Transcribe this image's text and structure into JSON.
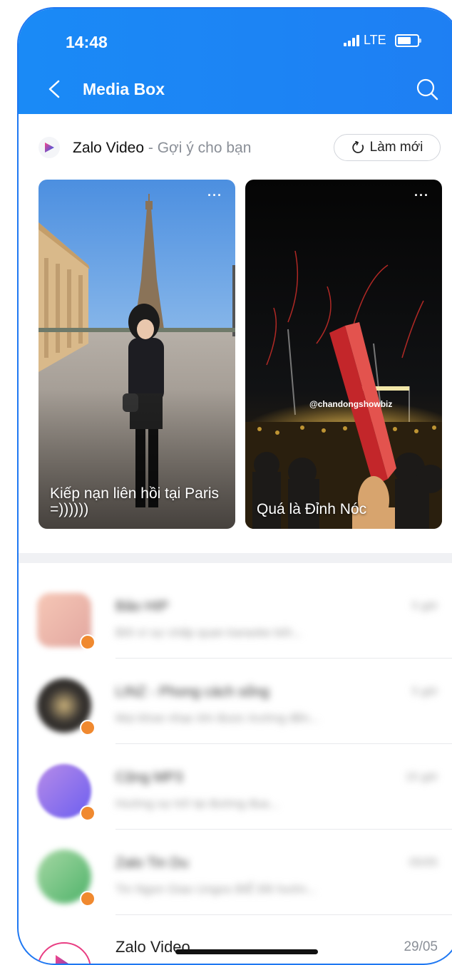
{
  "status_bar": {
    "time": "14:48",
    "network": "LTE"
  },
  "header": {
    "title": "Media Box"
  },
  "zalo_video_section": {
    "brand": "Zalo Video",
    "separator": " - ",
    "subtitle": "Gợi ý cho bạn",
    "refresh_label": "Làm mới"
  },
  "video_cards": [
    {
      "caption": "Kiếp nạn liên hồi tại Paris =))))))",
      "menu": "···"
    },
    {
      "caption": "Quá là Đỉnh Nóc",
      "menu": "···",
      "watermark": "@chandongshowbiz"
    }
  ],
  "conversations": [
    {
      "name": "Bảo HIP",
      "preview": "Bởi vì sự chấp quan karaoke bởi...",
      "time": "5 giờ"
    },
    {
      "name": "LINZ - Phong cách sống",
      "preview": "Mọi khoe nhạc khi được trường đến...",
      "time": "5 giờ"
    },
    {
      "name": "Cộng MP3",
      "preview": "Hướng sự trở lại đường đua...",
      "time": "15 giờ"
    },
    {
      "name": "Zalo Tin Du",
      "preview": "Tin Ngon Giao Ungos BIỂ Đề hướn...",
      "time": "05/05"
    }
  ],
  "zalo_video_row": {
    "name": "Zalo Video",
    "date": "29/05"
  },
  "colors": {
    "header_blue": "#1e7ff3",
    "accent_orange": "#f0892f",
    "zalo_pink": "#e93e83"
  }
}
